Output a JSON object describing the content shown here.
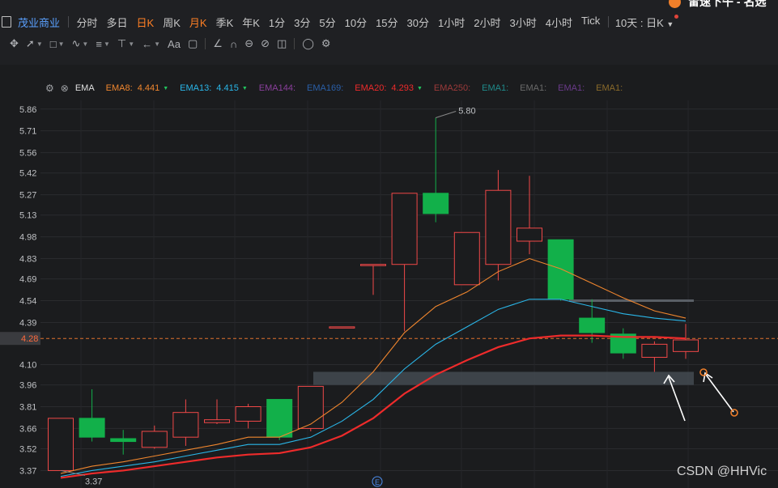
{
  "brand": {
    "text": "雷速下午 - 名选"
  },
  "header": {
    "stock_name": "茂业商业",
    "periods": [
      "分时",
      "多日",
      "日K",
      "周K",
      "月K",
      "季K",
      "年K",
      "1分",
      "3分",
      "5分",
      "10分",
      "15分",
      "30分",
      "1小时",
      "2小时",
      "3小时",
      "4小时",
      "Tick"
    ],
    "active_periods": [
      "日K",
      "月K"
    ],
    "range_select": "10天 : 日K"
  },
  "toolbar": {
    "icons": [
      "crosshair-icon",
      "line-tool-icon",
      "rect-tool-icon",
      "wave-tool-icon",
      "fib-tool-icon",
      "measure-tool-icon",
      "arrow-tool-icon",
      "text-tool-icon",
      "comment-tool-icon",
      "ruler-icon",
      "magnet-icon",
      "link-icon",
      "hide-icon",
      "trash-icon",
      "layers-icon",
      "settings-icon"
    ],
    "text_tool_label": "Aa"
  },
  "indicator": {
    "name": "EMA",
    "items": [
      {
        "label": "EMA8:",
        "value": "4.441",
        "color": "#f0862e",
        "arrow": "▼",
        "arrow_color": "#22c55e"
      },
      {
        "label": "EMA13:",
        "value": "4.415",
        "color": "#2ab6e8",
        "arrow": "▼",
        "arrow_color": "#22c55e"
      },
      {
        "label": "EMA144:",
        "value": "",
        "color": "#8a3f9c"
      },
      {
        "label": "EMA169:",
        "value": "",
        "color": "#2a5fa8"
      },
      {
        "label": "EMA20:",
        "value": "4.293",
        "color": "#ee2b2b",
        "arrow": "▼",
        "arrow_color": "#22c55e"
      },
      {
        "label": "EMA250:",
        "value": "",
        "color": "#9c3a3a"
      },
      {
        "label": "EMA1:",
        "value": "",
        "color": "#1f8a8a"
      },
      {
        "label": "EMA1:",
        "value": "",
        "color": "#6a6a6a"
      },
      {
        "label": "EMA1:",
        "value": "",
        "color": "#6a3a8a"
      },
      {
        "label": "EMA1:",
        "value": "",
        "color": "#8a6a2a"
      }
    ]
  },
  "chart_data": {
    "type": "candlestick",
    "y_ticks": [
      "5.86",
      "5.71",
      "5.56",
      "5.42",
      "5.27",
      "5.13",
      "4.98",
      "4.83",
      "4.69",
      "4.54",
      "4.39",
      "4.28",
      "4.10",
      "3.96",
      "3.81",
      "3.66",
      "3.52",
      "3.37"
    ],
    "ylim": [
      3.3,
      5.92
    ],
    "current_price": "4.28",
    "high_label": "5.80",
    "low_label": "3.37",
    "event_marker": "E",
    "candles": [
      {
        "o": 3.37,
        "h": 3.73,
        "l": 3.37,
        "c": 3.73
      },
      {
        "o": 3.73,
        "h": 3.93,
        "l": 3.57,
        "c": 3.6
      },
      {
        "o": 3.59,
        "h": 3.65,
        "l": 3.48,
        "c": 3.57
      },
      {
        "o": 3.53,
        "h": 3.68,
        "l": 3.52,
        "c": 3.64
      },
      {
        "o": 3.6,
        "h": 3.86,
        "l": 3.54,
        "c": 3.77
      },
      {
        "o": 3.7,
        "h": 3.86,
        "l": 3.69,
        "c": 3.72
      },
      {
        "o": 3.71,
        "h": 3.83,
        "l": 3.66,
        "c": 3.81
      },
      {
        "o": 3.86,
        "h": 3.86,
        "l": 3.58,
        "c": 3.6
      },
      {
        "o": 3.66,
        "h": 3.95,
        "l": 3.64,
        "c": 3.95
      },
      {
        "o": 4.36,
        "h": 4.36,
        "l": 4.35,
        "c": 4.36
      },
      {
        "o": 4.79,
        "h": 4.79,
        "l": 4.58,
        "c": 4.79
      },
      {
        "o": 4.79,
        "h": 5.28,
        "l": 4.33,
        "c": 5.28
      },
      {
        "o": 5.28,
        "h": 5.8,
        "l": 5.08,
        "c": 5.14
      },
      {
        "o": 4.65,
        "h": 5.01,
        "l": 4.65,
        "c": 5.01
      },
      {
        "o": 4.79,
        "h": 5.44,
        "l": 4.68,
        "c": 5.3
      },
      {
        "o": 4.95,
        "h": 5.4,
        "l": 4.86,
        "c": 5.04
      },
      {
        "o": 4.96,
        "h": 4.96,
        "l": 4.54,
        "c": 4.55
      },
      {
        "o": 4.42,
        "h": 4.55,
        "l": 4.25,
        "c": 4.32
      },
      {
        "o": 4.31,
        "h": 4.35,
        "l": 4.14,
        "c": 4.18
      },
      {
        "o": 4.15,
        "h": 4.26,
        "l": 4.05,
        "c": 4.24
      },
      {
        "o": 4.19,
        "h": 4.38,
        "l": 4.14,
        "c": 4.27
      }
    ],
    "series": [
      {
        "name": "EMA8",
        "color": "#f0862e",
        "values": [
          3.35,
          3.4,
          3.43,
          3.47,
          3.51,
          3.55,
          3.6,
          3.6,
          3.69,
          3.84,
          4.05,
          4.32,
          4.5,
          4.6,
          4.74,
          4.83,
          4.76,
          4.66,
          4.56,
          4.47,
          4.42
        ]
      },
      {
        "name": "EMA13",
        "color": "#2ab6e8",
        "values": [
          3.33,
          3.37,
          3.4,
          3.43,
          3.47,
          3.51,
          3.55,
          3.55,
          3.6,
          3.71,
          3.86,
          4.07,
          4.24,
          4.36,
          4.48,
          4.55,
          4.55,
          4.5,
          4.45,
          4.42,
          4.4
        ]
      },
      {
        "name": "EMA20",
        "color": "#ee2b2b",
        "values": [
          3.32,
          3.35,
          3.37,
          3.4,
          3.43,
          3.46,
          3.48,
          3.49,
          3.53,
          3.61,
          3.73,
          3.9,
          4.03,
          4.13,
          4.22,
          4.28,
          4.3,
          4.3,
          4.29,
          4.29,
          4.28
        ]
      }
    ]
  },
  "watermark": "CSDN @HHVic"
}
